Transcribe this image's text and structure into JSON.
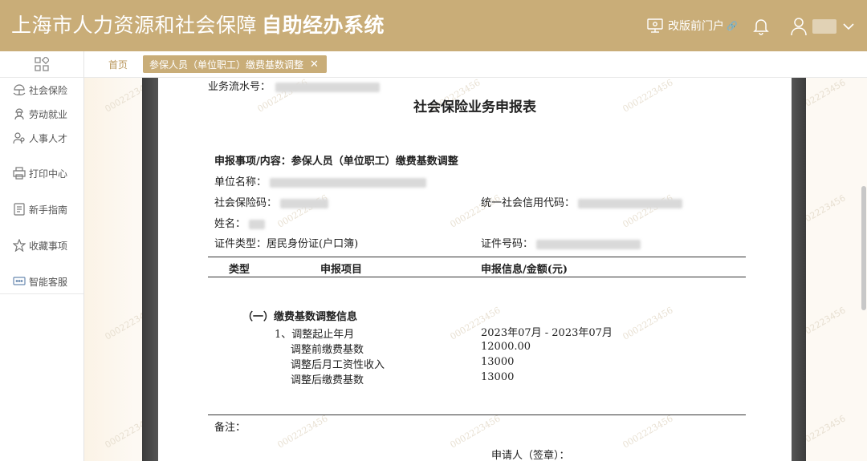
{
  "header": {
    "title_regular": "上海市人力资源和社会保障",
    "title_bold": "自助经办系统",
    "portal_label": "改版前门户"
  },
  "sidebar": {
    "items": [
      {
        "label": "社会保险",
        "icon": "umbrella-hands-icon"
      },
      {
        "label": "劳动就业",
        "icon": "worker-icon"
      },
      {
        "label": "人事人才",
        "icon": "people-icon"
      },
      {
        "label": "打印中心",
        "icon": "printer-icon"
      },
      {
        "label": "新手指南",
        "icon": "guide-icon"
      },
      {
        "label": "收藏事项",
        "icon": "star-icon"
      },
      {
        "label": "智能客服",
        "icon": "chat-icon"
      }
    ]
  },
  "tabs": {
    "home": "首页",
    "active": "参保人员（单位职工）缴费基数调整"
  },
  "watermark": "0002223456",
  "document": {
    "serial_label": "业务流水号：",
    "title": "社会保险业务申报表",
    "item_label": "申报事项/内容：参保人员（单位职工）缴费基数调整",
    "unit_name_label": "单位名称：",
    "social_code_label": "社会保险码：",
    "credit_code_label": "统一社会信用代码：",
    "name_label": "姓名：",
    "id_type_label": "证件类型：",
    "id_type_value": "居民身份证(户口簿)",
    "id_no_label": "证件号码：",
    "columns": [
      "类型",
      "申报项目",
      "申报信息/金额(元)"
    ],
    "section": "（一）缴费基数调整信息",
    "rows": [
      {
        "label": "1、调整起止年月",
        "value": "2023年07月   -   2023年07月"
      },
      {
        "label": "调整前缴费基数",
        "value": "12000.00"
      },
      {
        "label": "调整后月工资性收入",
        "value": "13000"
      },
      {
        "label": "调整后缴费基数",
        "value": "13000"
      }
    ],
    "remarks_label": "备注：",
    "applicant_label": "申请人（签章）："
  }
}
